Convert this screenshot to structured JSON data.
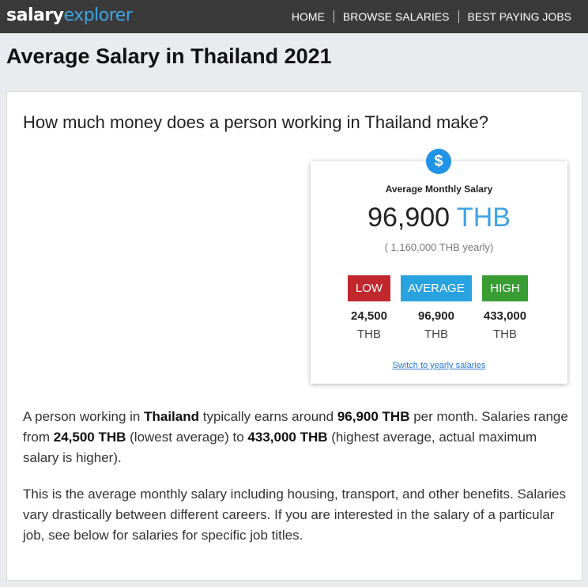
{
  "header": {
    "logo_part1": "salary",
    "logo_part2": "explorer",
    "nav": [
      "HOME",
      "BROWSE SALARIES",
      "BEST PAYING JOBS"
    ]
  },
  "page_title": "Average Salary in Thailand 2021",
  "question": "How much money does a person working in Thailand make?",
  "salary_box": {
    "icon": "$",
    "label": "Average Monthly Salary",
    "amount": "96,900",
    "currency": "THB",
    "yearly": "( 1,160,000 THB yearly)",
    "tiers": [
      {
        "tag": "LOW",
        "value": "24,500",
        "unit": "THB",
        "color": "#c0282d"
      },
      {
        "tag": "AVERAGE",
        "value": "96,900",
        "unit": "THB",
        "color": "#29a3e0"
      },
      {
        "tag": "HIGH",
        "value": "433,000",
        "unit": "THB",
        "color": "#3a9d34"
      }
    ],
    "switch_link": "Switch to yearly salaries"
  },
  "paragraph1": {
    "t1": "A person working in ",
    "country": "Thailand",
    "t2": " typically earns around ",
    "avg": "96,900 THB",
    "t3": " per month. Salaries range from ",
    "low": "24,500 THB",
    "t4": " (lowest average) to ",
    "high": "433,000 THB",
    "t5": " (highest average, actual maximum salary is higher)."
  },
  "paragraph2": "This is the average monthly salary including housing, transport, and other benefits. Salaries vary drastically between different careers. If you are interested in the salary of a particular job, see below for salaries for specific job titles.",
  "colors": {
    "brand_blue": "#3fa4e3",
    "topbar": "#3a3a3a"
  }
}
